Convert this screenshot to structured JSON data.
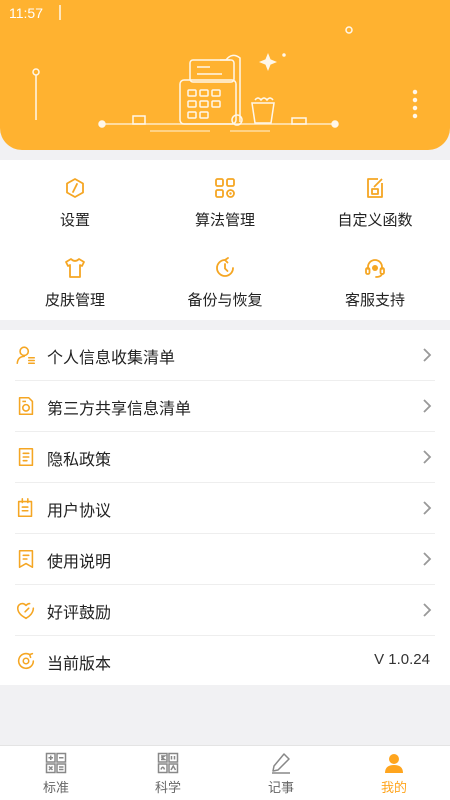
{
  "status_bar": {
    "time": "11:57"
  },
  "colors": {
    "accent": "#ffb230",
    "icon": "#f5a623",
    "active_nav": "#ffa51e"
  },
  "grid": [
    {
      "label": "设置",
      "icon": "settings-icon"
    },
    {
      "label": "算法管理",
      "icon": "apps-icon"
    },
    {
      "label": "自定义函数",
      "icon": "custom-function-icon"
    },
    {
      "label": "皮肤管理",
      "icon": "shirt-icon"
    },
    {
      "label": "备份与恢复",
      "icon": "restore-icon"
    },
    {
      "label": "客服支持",
      "icon": "headset-icon"
    }
  ],
  "list": [
    {
      "label": "个人信息收集清单",
      "icon": "user-list-icon"
    },
    {
      "label": "第三方共享信息清单",
      "icon": "share-doc-icon"
    },
    {
      "label": "隐私政策",
      "icon": "document-icon"
    },
    {
      "label": "用户协议",
      "icon": "agreement-icon"
    },
    {
      "label": "使用说明",
      "icon": "bookmark-icon"
    },
    {
      "label": "好评鼓励",
      "icon": "thumb-up-icon"
    },
    {
      "label": "当前版本",
      "icon": "version-icon",
      "value": "V 1.0.24"
    }
  ],
  "nav": [
    {
      "label": "标准",
      "icon": "standard-calculator-icon",
      "active": false
    },
    {
      "label": "科学",
      "icon": "scientific-calculator-icon",
      "active": false
    },
    {
      "label": "记事",
      "icon": "pencil-icon",
      "active": false
    },
    {
      "label": "我的",
      "icon": "profile-icon",
      "active": true
    }
  ]
}
